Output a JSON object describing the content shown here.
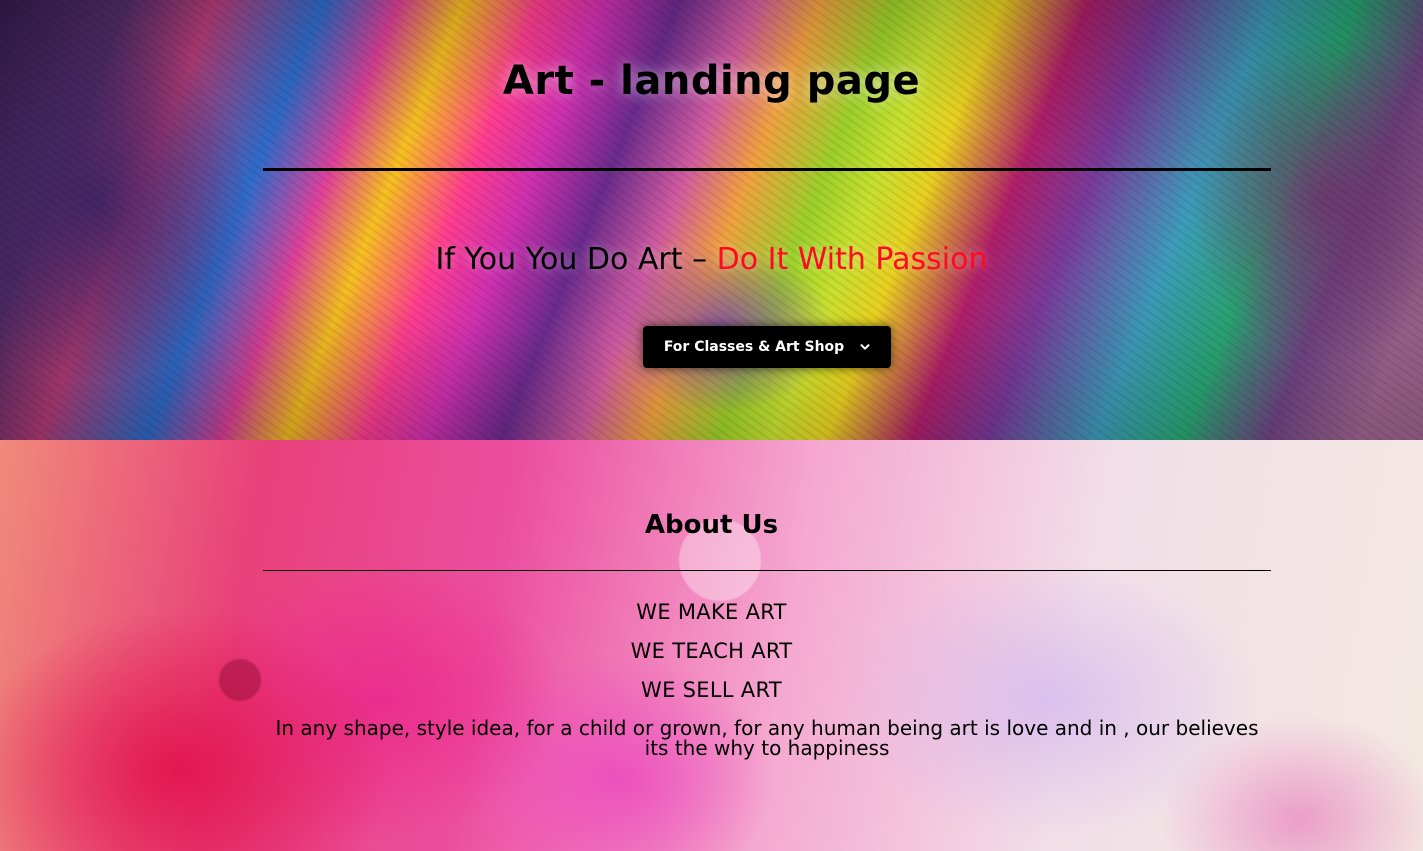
{
  "hero": {
    "title": "Art - landing page",
    "tagline_prefix": "If You You Do Art  – ",
    "tagline_accent": "Do It With Passion",
    "cta_label": "For Classes & Art Shop",
    "cta_icon": "chevron-down-icon"
  },
  "about": {
    "title": "About Us",
    "lines": [
      "WE MAKE ART",
      "WE TEACH ART",
      "WE SELL ART"
    ],
    "description": "In any shape, style idea, for a child or  grown, for any human being art is love and in , our believes its the why to happiness"
  },
  "colors": {
    "accent": "#ff0a1e",
    "button_bg": "#000000",
    "text": "#000000"
  }
}
